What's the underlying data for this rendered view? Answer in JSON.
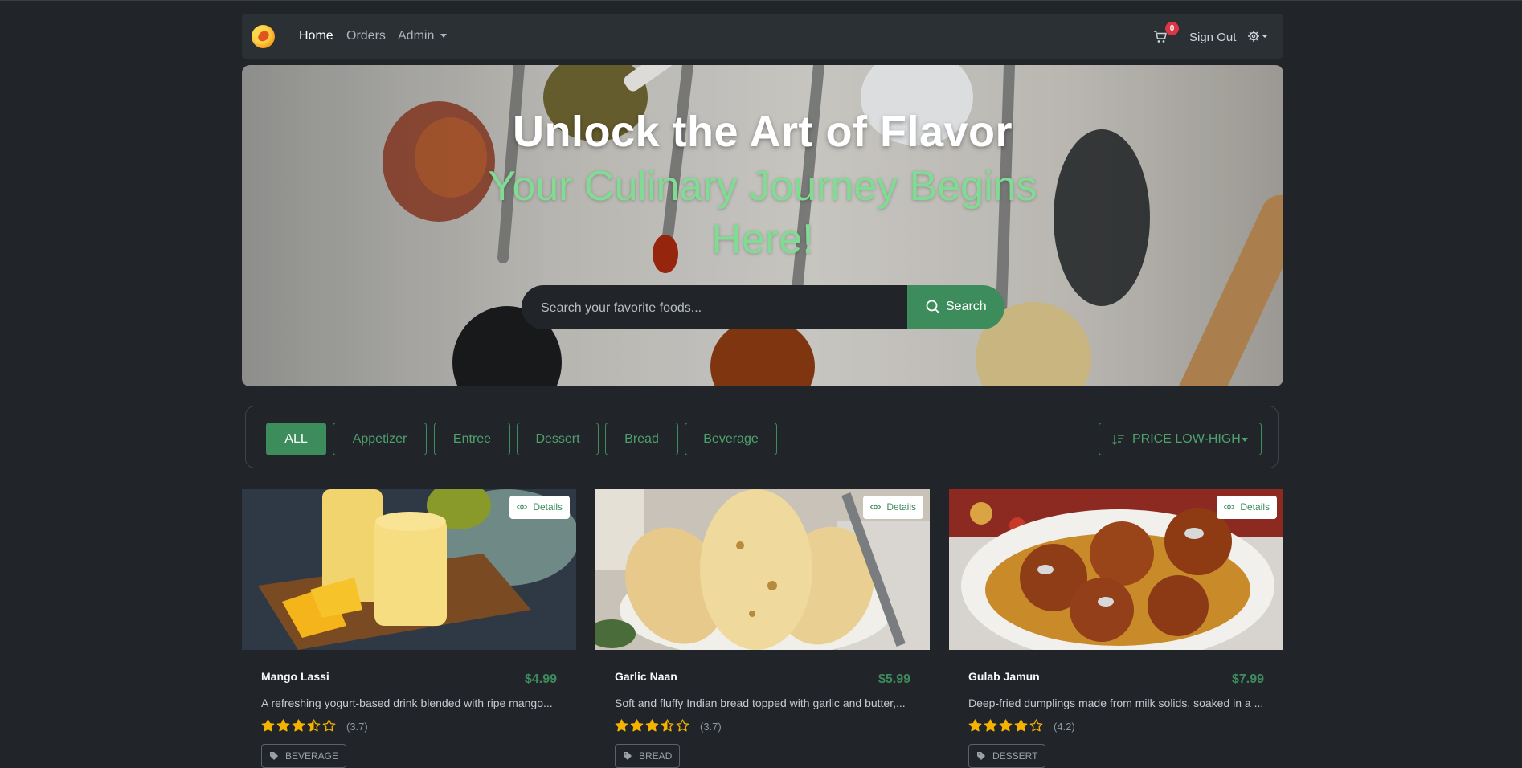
{
  "nav": {
    "links": [
      "Home",
      "Orders",
      "Admin"
    ],
    "cart_count": "0",
    "sign_out": "Sign Out"
  },
  "hero": {
    "title": "Unlock the Art of Flavor",
    "subtitle": "Your Culinary Journey Begins Here!",
    "search_placeholder": "Search your favorite foods...",
    "search_button": "Search"
  },
  "filters": {
    "categories": [
      "ALL",
      "Appetizer",
      "Entree",
      "Dessert",
      "Bread",
      "Beverage"
    ],
    "active": "ALL",
    "sort_label": "PRICE LOW-HIGH"
  },
  "items": [
    {
      "name": "Mango Lassi",
      "price": "$4.99",
      "description": "A refreshing yogurt-based drink blended with ripe mango...",
      "rating": 3.7,
      "rating_text": "(3.7)",
      "category": "BEVERAGE",
      "details_label": "Details"
    },
    {
      "name": "Garlic Naan",
      "price": "$5.99",
      "description": "Soft and fluffy Indian bread topped with garlic and butter,...",
      "rating": 3.7,
      "rating_text": "(3.7)",
      "category": "BREAD",
      "details_label": "Details"
    },
    {
      "name": "Gulab Jamun",
      "price": "$7.99",
      "description": "Deep-fried dumplings made from milk solids, soaked in a ...",
      "rating": 4.2,
      "rating_text": "(4.2)",
      "category": "DESSERT",
      "details_label": "Details"
    }
  ],
  "colors": {
    "background": "#212529",
    "navbar": "#2b3035",
    "accent_green": "#3d8c5c",
    "subtitle_green": "#7fdc92",
    "star": "#f5b301",
    "badge_red": "#dc3545"
  },
  "icons": [
    "logo",
    "cart-icon",
    "settings-gear-icon",
    "search-icon",
    "sort-icon",
    "eye-icon",
    "tag-icon",
    "star-icon"
  ]
}
